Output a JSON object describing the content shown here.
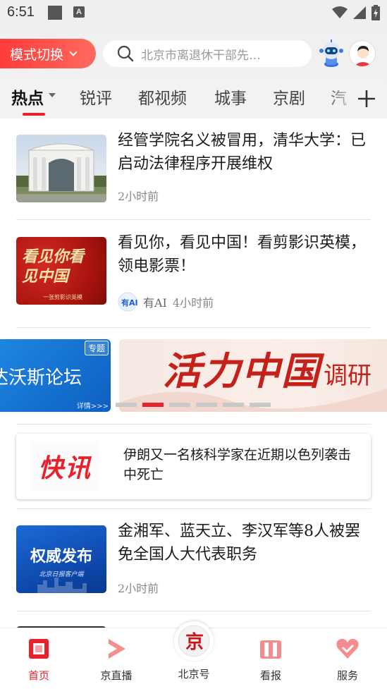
{
  "status_bar": {
    "time": "6:51",
    "badge_letter": "A"
  },
  "header": {
    "mode_button": "模式切换",
    "search_placeholder": "北京市离退休干部先…",
    "tabs": [
      "热点",
      "锐评",
      "都视频",
      "城事",
      "京剧",
      "汽"
    ]
  },
  "feed": [
    {
      "title": "经管学院名义被冒用，清华大学：已启动法律程序开展维权",
      "meta": "2小时前"
    },
    {
      "title": "看见你，看见中国！看剪影识英模，领电影票！",
      "source": "有AI",
      "meta": "4小时前",
      "thumb_text": "看见你看见中国",
      "thumb_sub": "一张剪影识英模"
    },
    {
      "title": "金湘军、蓝天立、李汉军等8人被罢免全国人大代表职务",
      "meta": "2小时前",
      "thumb_text": "权威发布",
      "thumb_sub": "北京日报客户端"
    }
  ],
  "banner": {
    "left_text": "达沃斯论坛",
    "left_tag": "专题",
    "left_more": "详情>>>",
    "main_text": "活力中国",
    "main_suffix": "调研",
    "active_index": 1,
    "dot_count": 6
  },
  "flash": {
    "logo": "快讯",
    "text": "伊朗又一名核科学家在近期以色列袭击中死亡"
  },
  "bottom_nav": [
    {
      "label": "首页",
      "icon": "home-icon",
      "active": true
    },
    {
      "label": "京直播",
      "icon": "live-play-icon",
      "active": false
    },
    {
      "label": "北京号",
      "icon": "beijing-logo-icon",
      "active": false
    },
    {
      "label": "看报",
      "icon": "newspaper-icon",
      "active": false
    },
    {
      "label": "服务",
      "icon": "heart-service-icon",
      "active": false
    }
  ],
  "colors": {
    "accent": "#e8212c",
    "banner_blue": "#1d86e0"
  }
}
